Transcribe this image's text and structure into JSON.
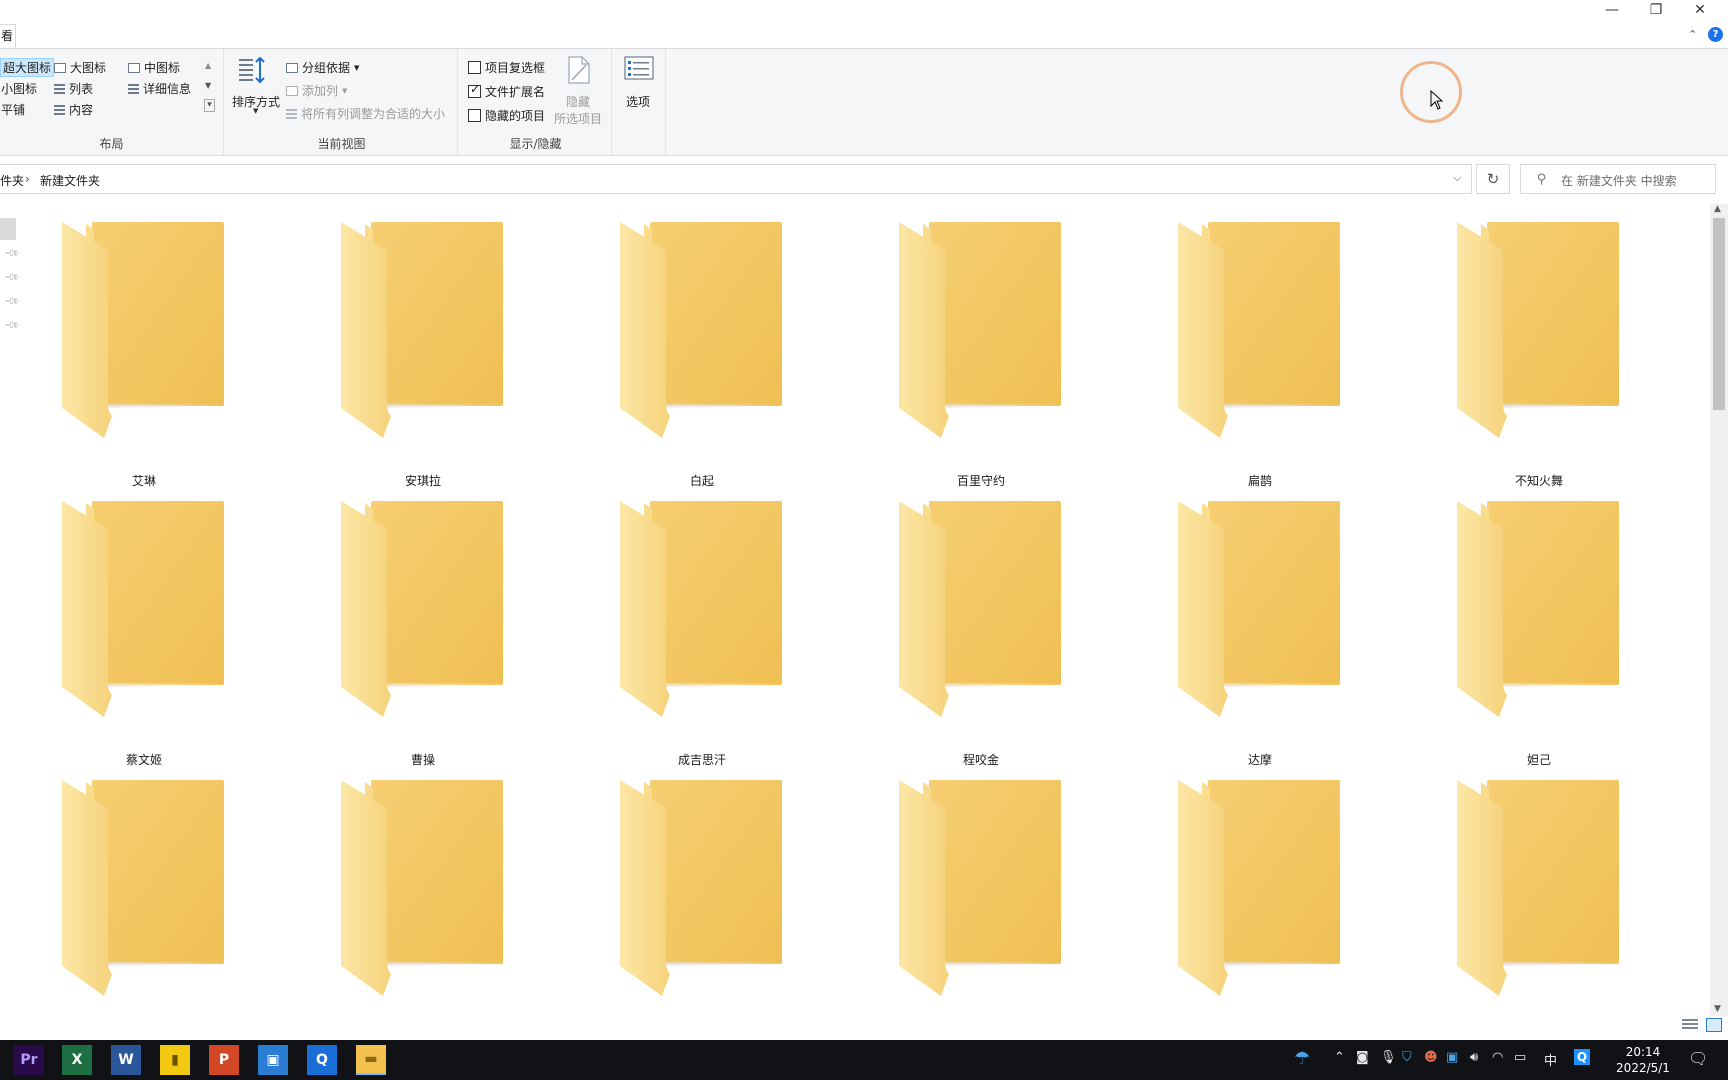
{
  "window": {
    "tab_view": "看",
    "minimize": "—",
    "restore": "❐",
    "close": "✕"
  },
  "ribbon": {
    "layout": {
      "title": "布局",
      "items": [
        "超大图标",
        "大图标",
        "中图标",
        "小图标",
        "列表",
        "详细信息",
        "平铺",
        "内容"
      ]
    },
    "current_view": {
      "title": "当前视图",
      "sort_by": "排序方式",
      "group_by": "分组依据",
      "add_column": "添加列",
      "fit_columns": "将所有列调整为合适的大小"
    },
    "show_hide": {
      "title": "显示/隐藏",
      "item_checkboxes": "项目复选框",
      "item_checkboxes_checked": false,
      "file_extensions": "文件扩展名",
      "file_extensions_checked": true,
      "hidden_items": "隐藏的项目",
      "hidden_items_checked": false,
      "hide_selected_line1": "隐藏",
      "hide_selected_line2": "所选项目"
    },
    "options": "选项"
  },
  "address": {
    "crumb_parent": "件夹",
    "separator": "›",
    "crumb_current": "新建文件夹",
    "refresh": "↻",
    "search_placeholder": "在 新建文件夹 中搜索"
  },
  "folders": [
    {
      "name": "艾琳"
    },
    {
      "name": "安琪拉"
    },
    {
      "name": "白起"
    },
    {
      "name": "百里守约"
    },
    {
      "name": "扁鹊"
    },
    {
      "name": "不知火舞"
    },
    {
      "name": "蔡文姬"
    },
    {
      "name": "曹操"
    },
    {
      "name": "成吉思汗"
    },
    {
      "name": "程咬金"
    },
    {
      "name": "达摩"
    },
    {
      "name": "妲己"
    },
    {
      "name": ""
    },
    {
      "name": ""
    },
    {
      "name": ""
    },
    {
      "name": ""
    },
    {
      "name": ""
    },
    {
      "name": ""
    }
  ],
  "taskbar": {
    "apps": [
      {
        "name": "premiere-icon",
        "glyph": "Pr",
        "color": "#2a0b4a",
        "fg": "#b29bff"
      },
      {
        "name": "excel-icon",
        "glyph": "X",
        "color": "#1d6f42",
        "fg": "#ffffff"
      },
      {
        "name": "word-icon",
        "glyph": "W",
        "color": "#2b579a",
        "fg": "#ffffff"
      },
      {
        "name": "powerbi-icon",
        "glyph": "▮",
        "color": "#f2c811",
        "fg": "#6b5200"
      },
      {
        "name": "powerpoint-icon",
        "glyph": "P",
        "color": "#d24726",
        "fg": "#ffffff"
      },
      {
        "name": "recorder-icon",
        "glyph": "▣",
        "color": "#2b7cd3",
        "fg": "#ffffff"
      },
      {
        "name": "qq-browser-icon",
        "glyph": "Q",
        "color": "#1a6fd6",
        "fg": "#ffffff"
      },
      {
        "name": "file-explorer-icon",
        "glyph": "▬",
        "color": "#f4c04e",
        "fg": "#8a6a12"
      }
    ],
    "ime": "中",
    "time": "20:14",
    "date": "2022/5/1"
  }
}
